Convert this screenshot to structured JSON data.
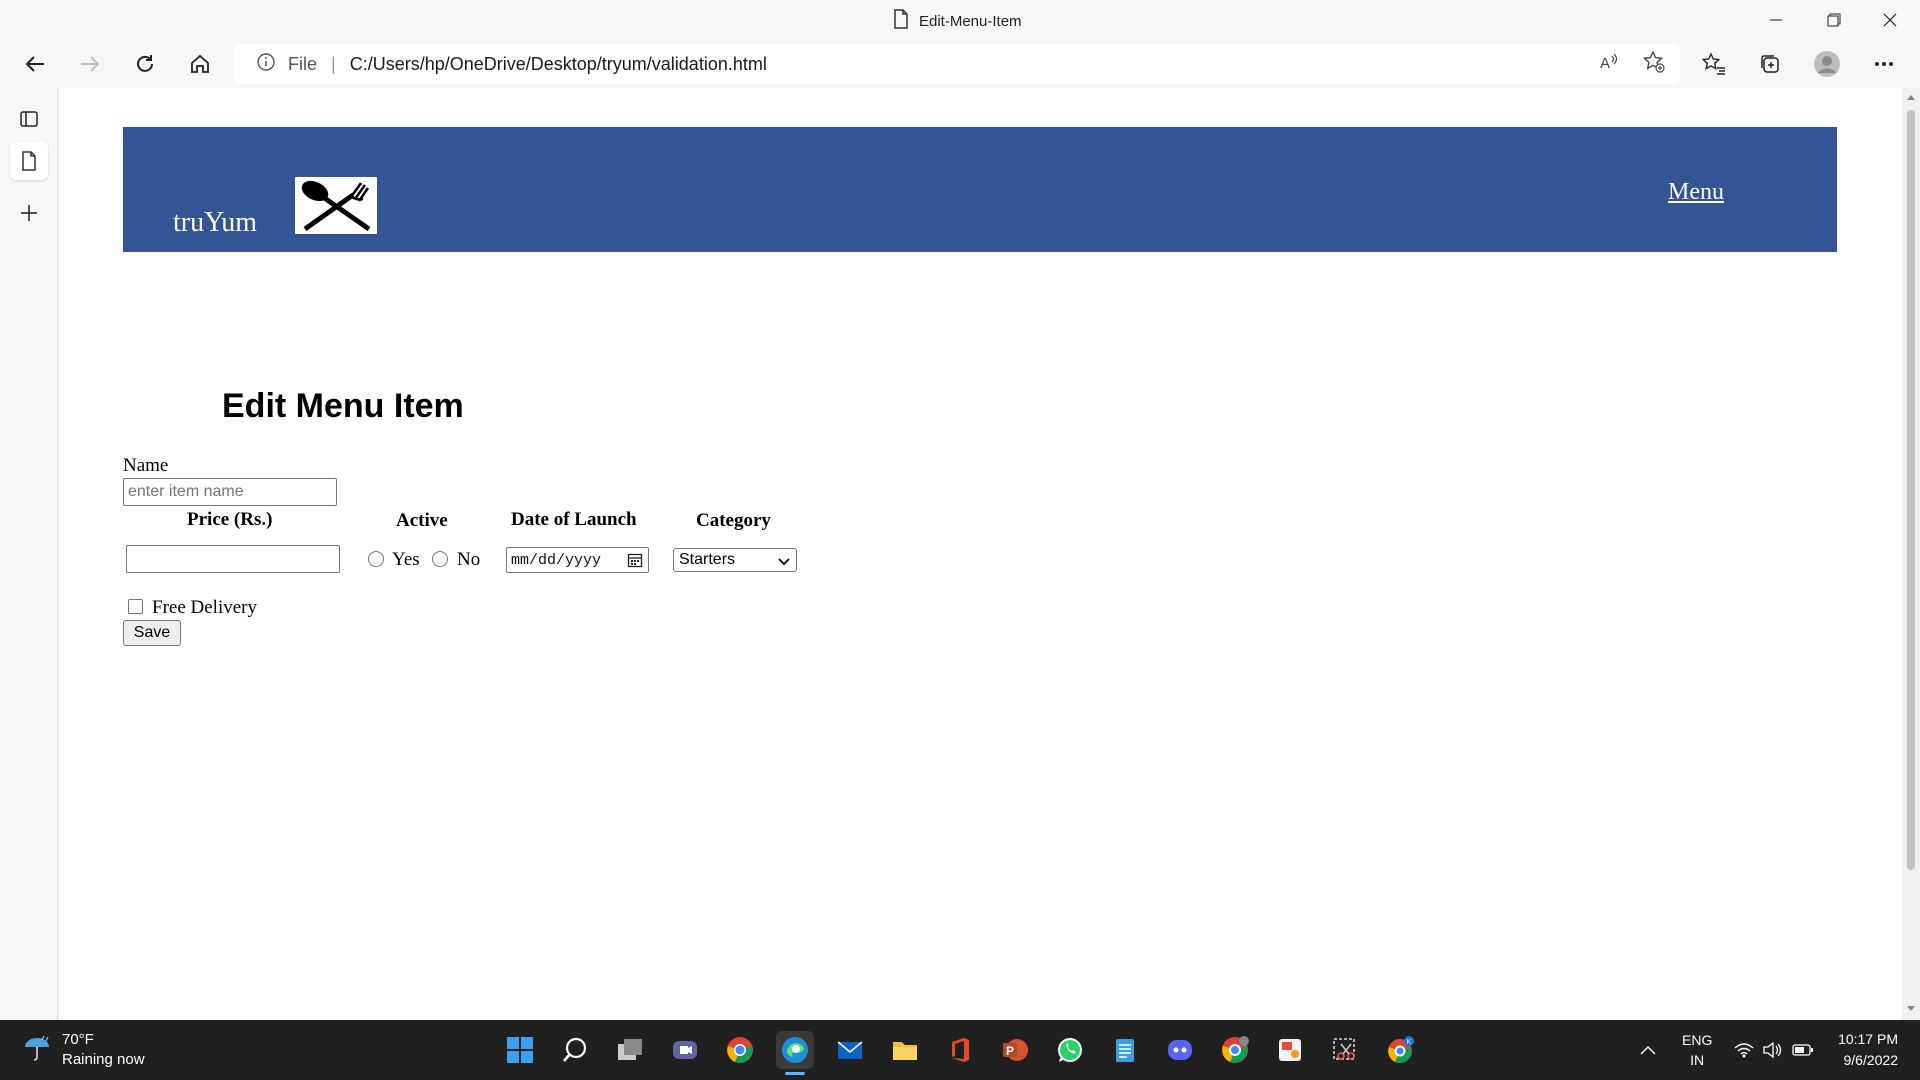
{
  "browser": {
    "tab_title": "Edit-Menu-Item",
    "address_scheme": "File",
    "address_url": "C:/Users/hp/OneDrive/Desktop/tryum/validation.html"
  },
  "header": {
    "brand": "truYum",
    "menu_link": "Menu"
  },
  "form": {
    "title": "Edit Menu Item",
    "name_label": "Name",
    "name_placeholder": "enter item name",
    "col_price": "Price (Rs.)",
    "col_active": "Active",
    "col_date": "Date of Launch",
    "col_category": "Category",
    "yes_label": "Yes",
    "no_label": "No",
    "date_placeholder": "mm/dd/yyyy",
    "category_selected": "Starters",
    "free_delivery_label": "Free Delivery",
    "save_label": "Save"
  },
  "taskbar": {
    "temperature": "70°F",
    "weather": "Raining now",
    "lang_top": "ENG",
    "lang_bottom": "IN",
    "time": "10:17 PM",
    "date": "9/6/2022"
  },
  "colors": {
    "header_bg": "#335495",
    "taskbar_bg": "#202020"
  }
}
